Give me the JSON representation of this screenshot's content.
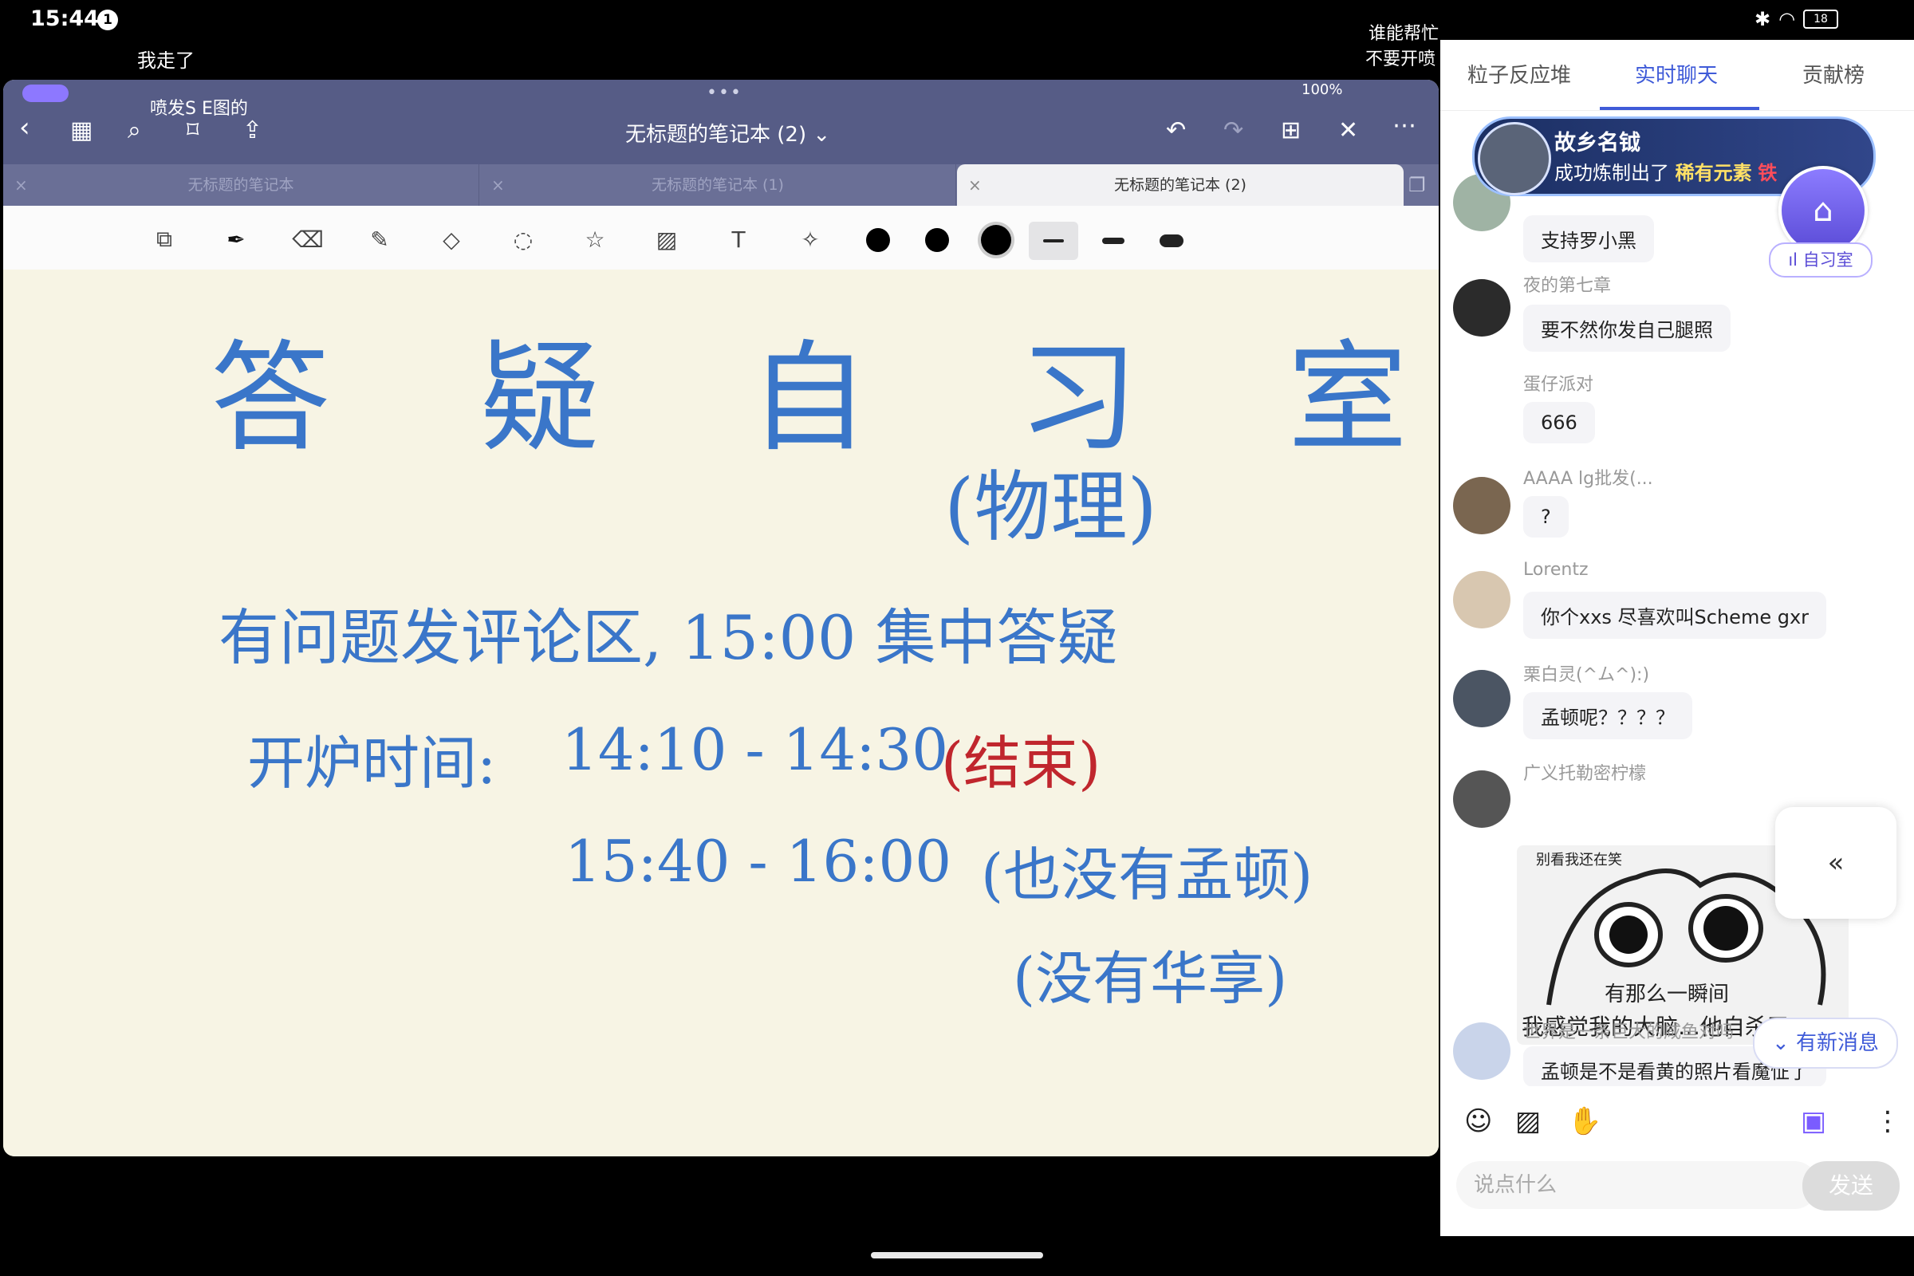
{
  "status": {
    "time": "15:44",
    "notification_count": "1",
    "battery": "18"
  },
  "danmaku": [
    "我走了",
    "喷发S E图的",
    "谁能帮忙",
    "不要开喷"
  ],
  "notes_app": {
    "title": "无标题的笔记本 (2)",
    "ipad_status": "100%",
    "tabs": [
      {
        "label": "无标题的笔记本",
        "active": false
      },
      {
        "label": "无标题的笔记本 (1)",
        "active": false
      },
      {
        "label": "无标题的笔记本 (2)",
        "active": true
      }
    ],
    "tab_close": "×",
    "tools": [
      "page-icon",
      "pen-icon",
      "eraser-icon",
      "highlighter-icon",
      "shapes-icon",
      "lasso-icon",
      "sticker-icon",
      "image-icon",
      "text-icon",
      "laser-icon"
    ],
    "pen_colors": [
      "#000000",
      "#000000",
      "#000000"
    ],
    "handwriting": {
      "title": "答 疑 自 习 室",
      "subject": "(物理)",
      "line1": "有问题发评论区, 15:00 集中答疑",
      "line2_label": "开炉时间:",
      "line2_time": "14:10 - 14:30",
      "line2_note": "(结束)",
      "line3_time": "15:40 - 16:00",
      "line3_note": "(也没有孟顿)",
      "line4_note": "(没有华享)"
    }
  },
  "chat": {
    "tabs": [
      "粒子反应堆",
      "实时聊天",
      "贡献榜"
    ],
    "active_tab": 1,
    "banner": {
      "name": "故乡名钺",
      "text_prefix": "成功炼制出了",
      "highlight": "稀有元素",
      "highlight2": "铁"
    },
    "study_room": {
      "label": "自习室"
    },
    "messages": [
      {
        "user": "",
        "text": "支持罗小黑"
      },
      {
        "user": "夜的第七章",
        "text": "要不然你发自己腿照"
      },
      {
        "user": "蛋仔派对",
        "text": "666"
      },
      {
        "user": "AAAA lg批发(...",
        "text": "?"
      },
      {
        "user": "Lorentz",
        "text": "你个xxs 尽喜欢叫Scheme gxr"
      },
      {
        "user": "栗白灵(^ム^):)",
        "text": "孟顿呢？？？？"
      },
      {
        "user": "广义托勒密柠檬",
        "text": ""
      },
      {
        "user": "世界是一条巨大的咸鱼对吗",
        "text": "孟顿是不是看黄的照片看魔怔了"
      }
    ],
    "meme": {
      "top": "别看我还在笑",
      "mid": "有那么一瞬间",
      "bot": "我感觉我的大脑…他自杀了"
    },
    "collapse_icon": "«",
    "new_messages": "有新消息",
    "input_placeholder": "说点什么",
    "send_label": "发送"
  }
}
